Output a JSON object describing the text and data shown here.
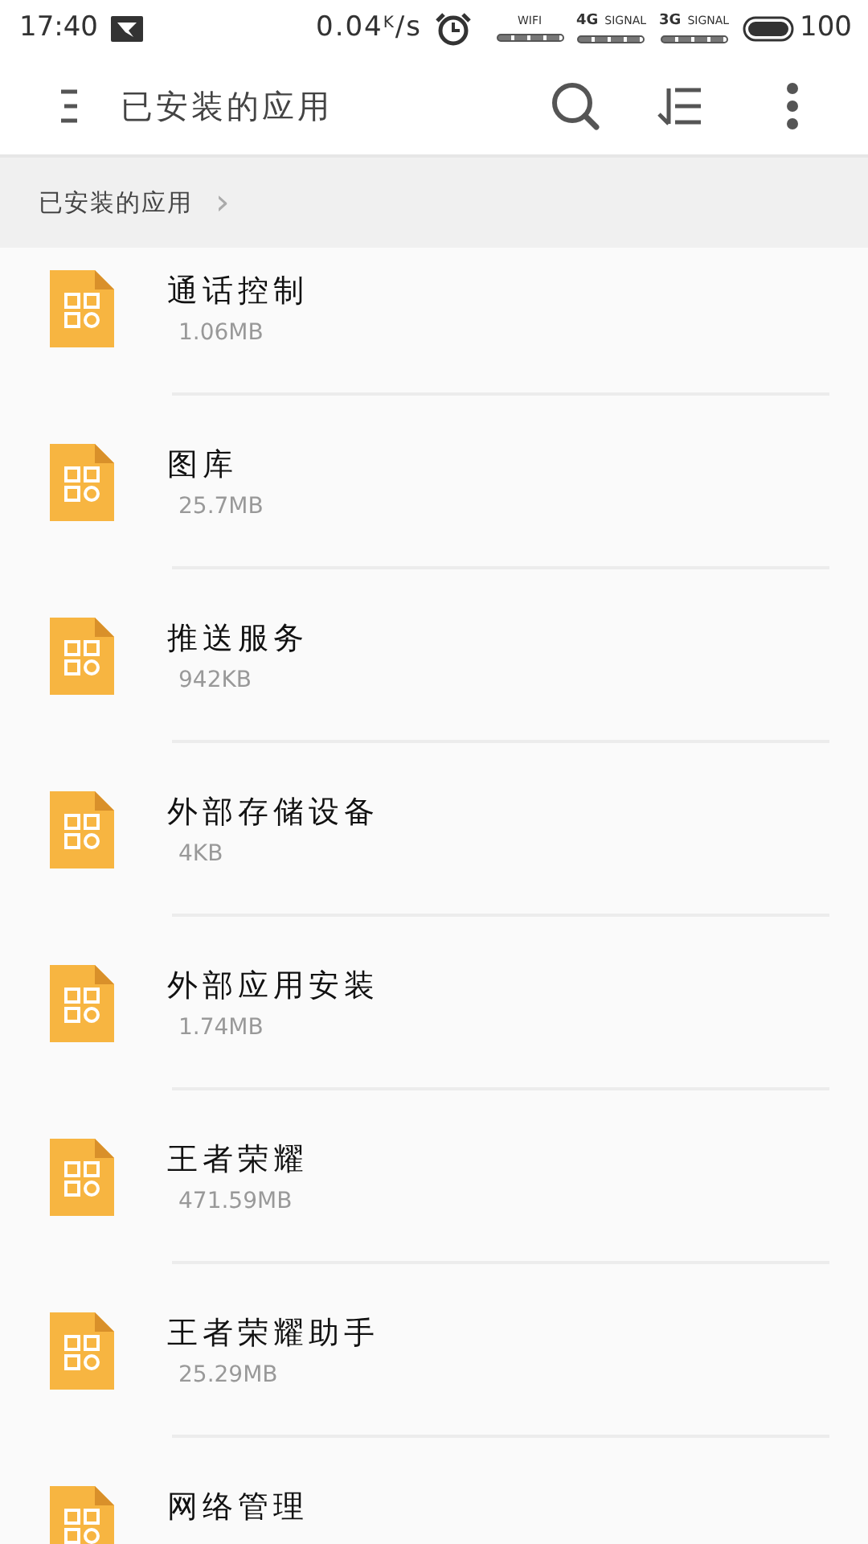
{
  "status_bar": {
    "time": "17:40",
    "speed": "0.04$^{K}$/s",
    "wifi_label": "WIFI",
    "signals": [
      {
        "label": "4G",
        "sub": "SIGNAL"
      },
      {
        "label": "3G",
        "sub": "SIGNAL"
      }
    ],
    "battery": "100"
  },
  "app_bar": {
    "title": "已安装的应用"
  },
  "breadcrumb": {
    "label": "已安装的应用",
    "chevron": "›"
  },
  "apps": [
    {
      "name": "通话控制",
      "size": "1.06MB"
    },
    {
      "name": "图库",
      "size": "25.7MB"
    },
    {
      "name": "推送服务",
      "size": "942KB"
    },
    {
      "name": "外部存储设备",
      "size": "4KB"
    },
    {
      "name": "外部应用安装",
      "size": "1.74MB"
    },
    {
      "name": "王者荣耀",
      "size": "471.59MB"
    },
    {
      "name": "王者荣耀助手",
      "size": "25.29MB"
    },
    {
      "name": "网络管理"
    }
  ]
}
